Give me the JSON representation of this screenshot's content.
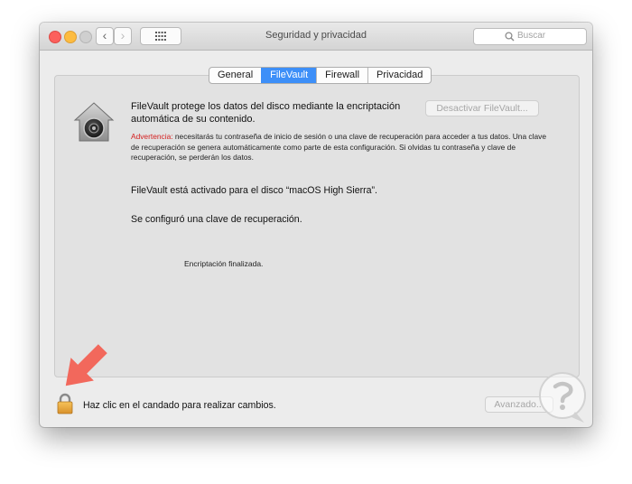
{
  "window": {
    "title": "Seguridad y privacidad",
    "nav_back": "‹",
    "nav_forward": "›",
    "search_placeholder": "Buscar"
  },
  "tabs": [
    {
      "label": "General",
      "active": false
    },
    {
      "label": "FileVault",
      "active": true
    },
    {
      "label": "Firewall",
      "active": false
    },
    {
      "label": "Privacidad",
      "active": false
    }
  ],
  "filevault": {
    "description": "FileVault protege los datos del disco mediante la encriptación automática de su contenido.",
    "deactivate_button": "Desactivar FileVault...",
    "warning_label": "Advertencia:",
    "warning_text": " necesitarás tu contraseña de inicio de sesión o una clave de recuperación para acceder a tus datos. Una clave de recuperación se genera automáticamente como parte de esta configuración. Si olvidas tu contraseña y clave de recuperación, se perderán los datos.",
    "status_enabled": "FileVault está activado para el disco “macOS High Sierra”.",
    "status_recovery": "Se configuró una clave de recuperación.",
    "encryption_status": "Encriptación finalizada."
  },
  "footer": {
    "lock_text": "Haz clic en el candado para realizar cambios.",
    "advanced_button": "Avanzado..."
  },
  "colors": {
    "tab_active": "#3d8ff8",
    "warning_label": "#d42020",
    "arrow": "#f2685c",
    "lock": "#e8a23a"
  },
  "icons": [
    "house-lock-icon",
    "padlock-icon",
    "search-icon",
    "grid-icon",
    "arrow-annotation"
  ]
}
